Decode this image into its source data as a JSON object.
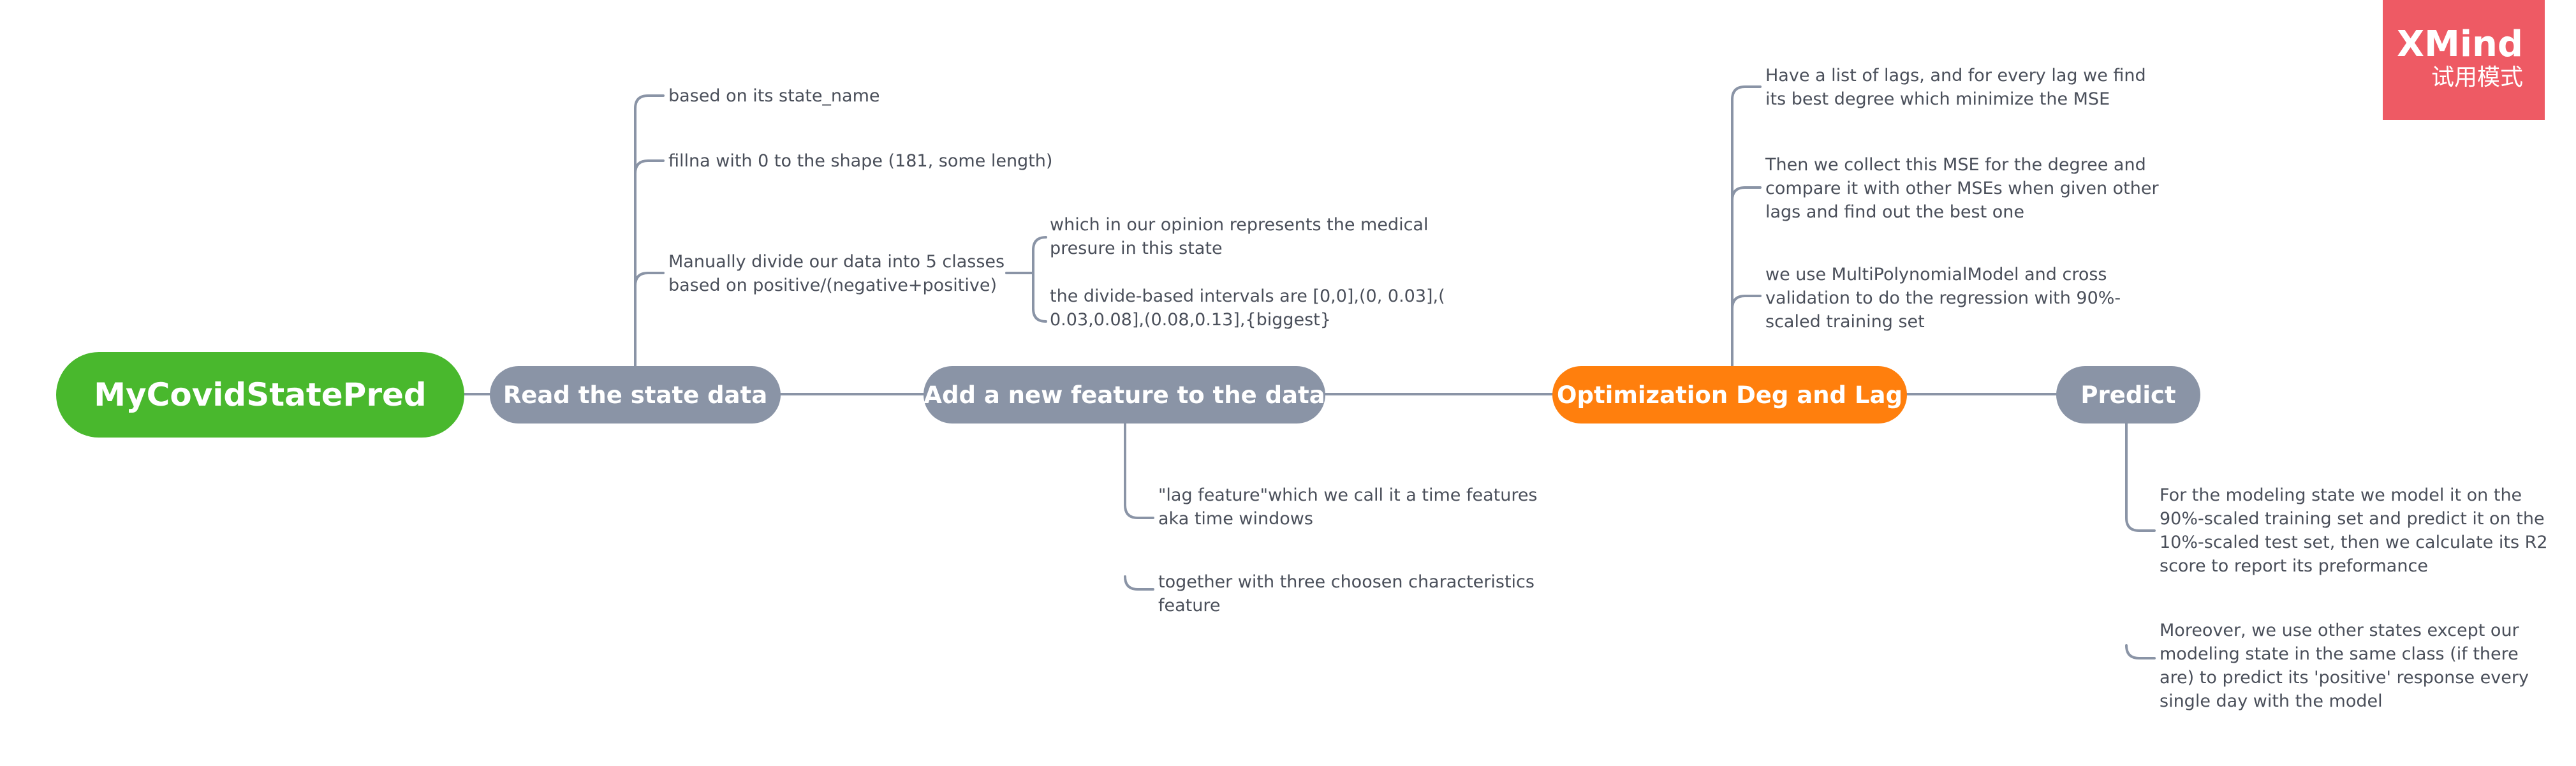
{
  "map": {
    "central_topic": "MyCovidStatePred",
    "topics": {
      "read": {
        "label": "Read the state data",
        "subtopics": [
          "based on its state_name",
          "fillna with 0 to the shape (181, some length)",
          "Manually divide our data into 5 classes\nbased on positive/(negative+positive)"
        ],
        "class_details": [
          "which in our opinion represents the medical\npresure in this state",
          "the divide-based intervals are [0,0],(0, 0.03],(\n0.03,0.08],(0.08,0.13],{biggest}"
        ]
      },
      "feature": {
        "label": "Add a new feature to the data",
        "subtopics": [
          "\"lag feature\"which we call it a time features\naka time windows",
          "together with three choosen characteristics\nfeature"
        ]
      },
      "optimize": {
        "label": "Optimization Deg and Lag",
        "color": "#ff7f0d",
        "subtopics": [
          "Have a list of lags, and for every lag we find\nits best degree which minimize the MSE",
          "Then we collect this MSE for the degree and\ncompare it with other MSEs when given other\nlags and find out the best one",
          "we use MultiPolynomialModel and cross\nvalidation to do the regression with 90%-\nscaled training set"
        ]
      },
      "predict": {
        "label": "Predict",
        "subtopics": [
          "For the modeling state we model it on the\n90%-scaled training set and predict it on the\n10%-scaled test set, then we calculate its R2\nscore to report its preformance",
          "Moreover, we use other states except our\nmodeling state in the same class (if there\nare) to predict its 'positive' response every\nsingle day with the model"
        ]
      }
    }
  },
  "watermark": {
    "brand": "XMind",
    "subtitle": "试用模式"
  },
  "colors": {
    "central": "#49b82d",
    "topic_gray": "#8a94a6",
    "topic_orange": "#ff7f0d",
    "connector": "#8a94a6",
    "text": "#4a4f5a",
    "watermark": "#ee5a64"
  }
}
